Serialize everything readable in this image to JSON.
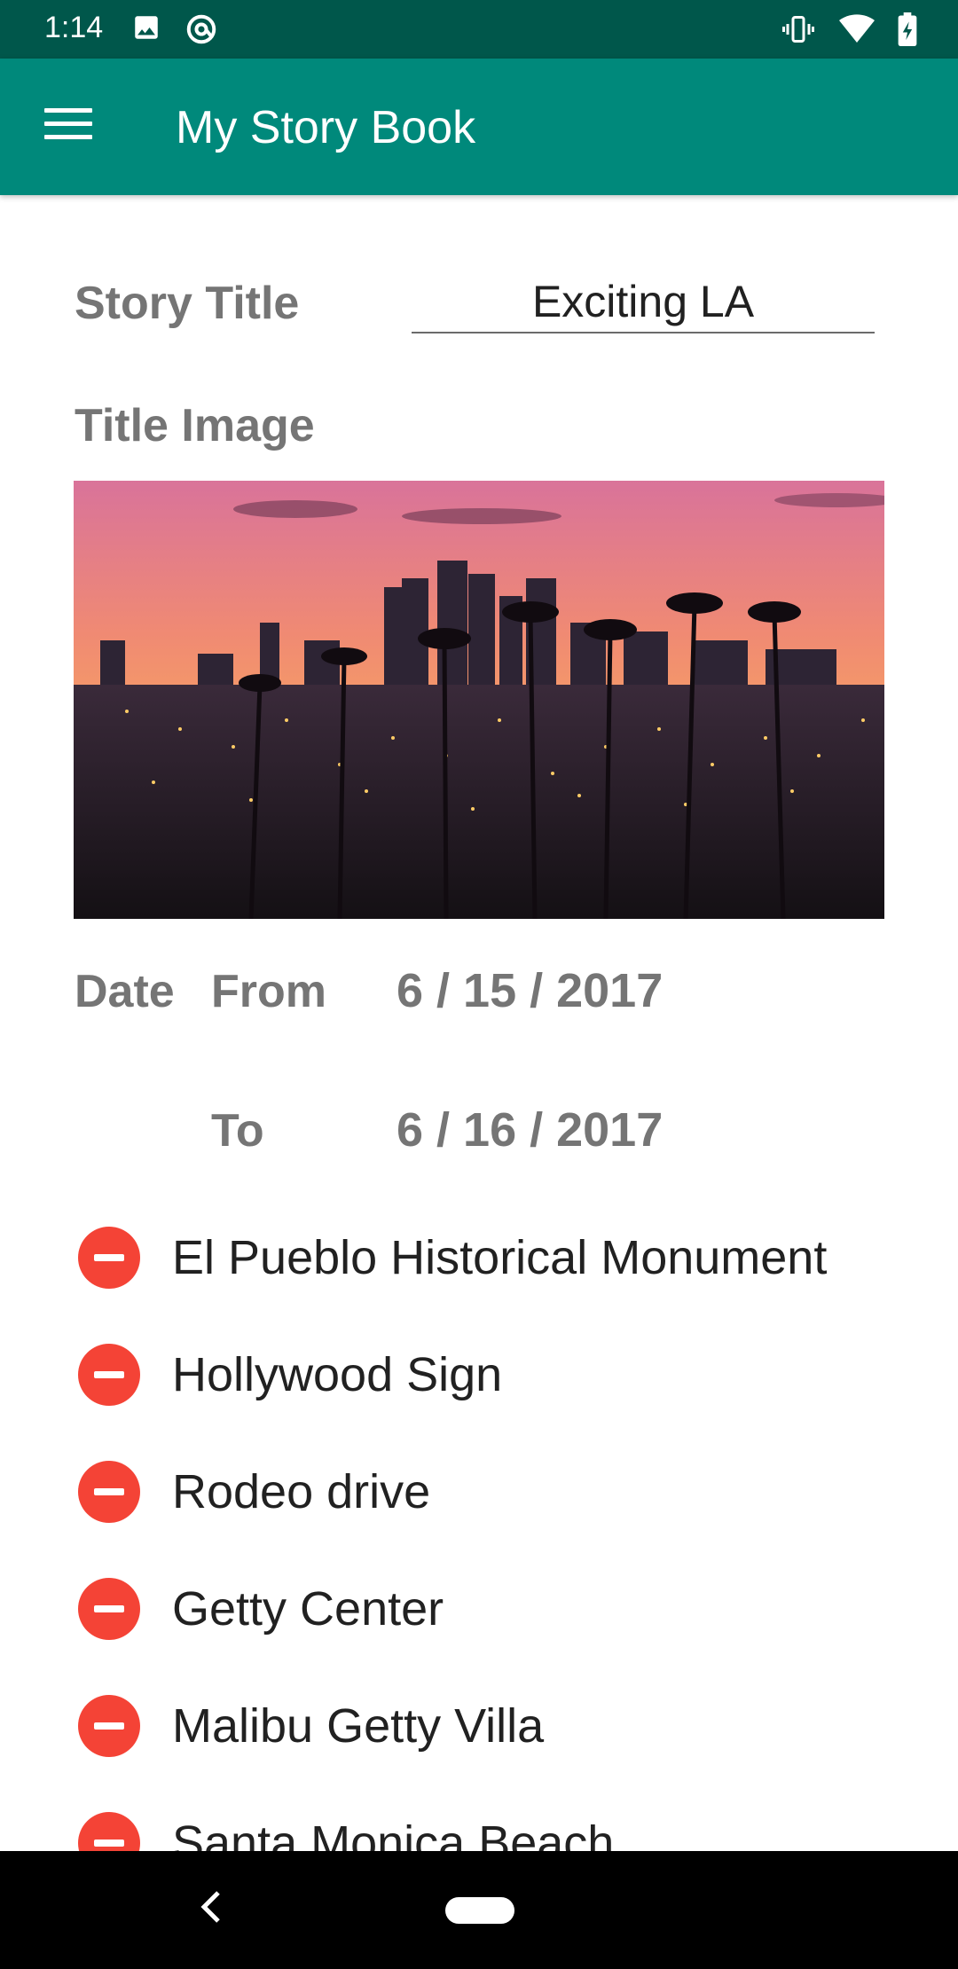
{
  "status_bar": {
    "time": "1:14",
    "icons": [
      "image-icon",
      "at-sign-icon",
      "vibrate-icon",
      "wifi-icon",
      "battery-charging-icon"
    ]
  },
  "app_bar": {
    "title": "My Story Book",
    "menu_icon": "menu-icon"
  },
  "form": {
    "story_title_label": "Story Title",
    "story_title_value": "Exciting LA",
    "title_image_label": "Title Image",
    "date_label": "Date",
    "from_label": "From",
    "from_value": "6 / 15 / 2017",
    "to_label": "To",
    "to_value": "6 / 16 / 2017"
  },
  "places": [
    {
      "label": "El Pueblo Historical Monument"
    },
    {
      "label": "Hollywood Sign"
    },
    {
      "label": "Rodeo drive"
    },
    {
      "label": "Getty Center"
    },
    {
      "label": "Malibu Getty Villa"
    },
    {
      "label": "Santa Monica Beach"
    }
  ],
  "colors": {
    "status_bar": "#00574b",
    "app_bar": "#00897b",
    "remove": "#f44336",
    "label_gray": "#757575"
  }
}
